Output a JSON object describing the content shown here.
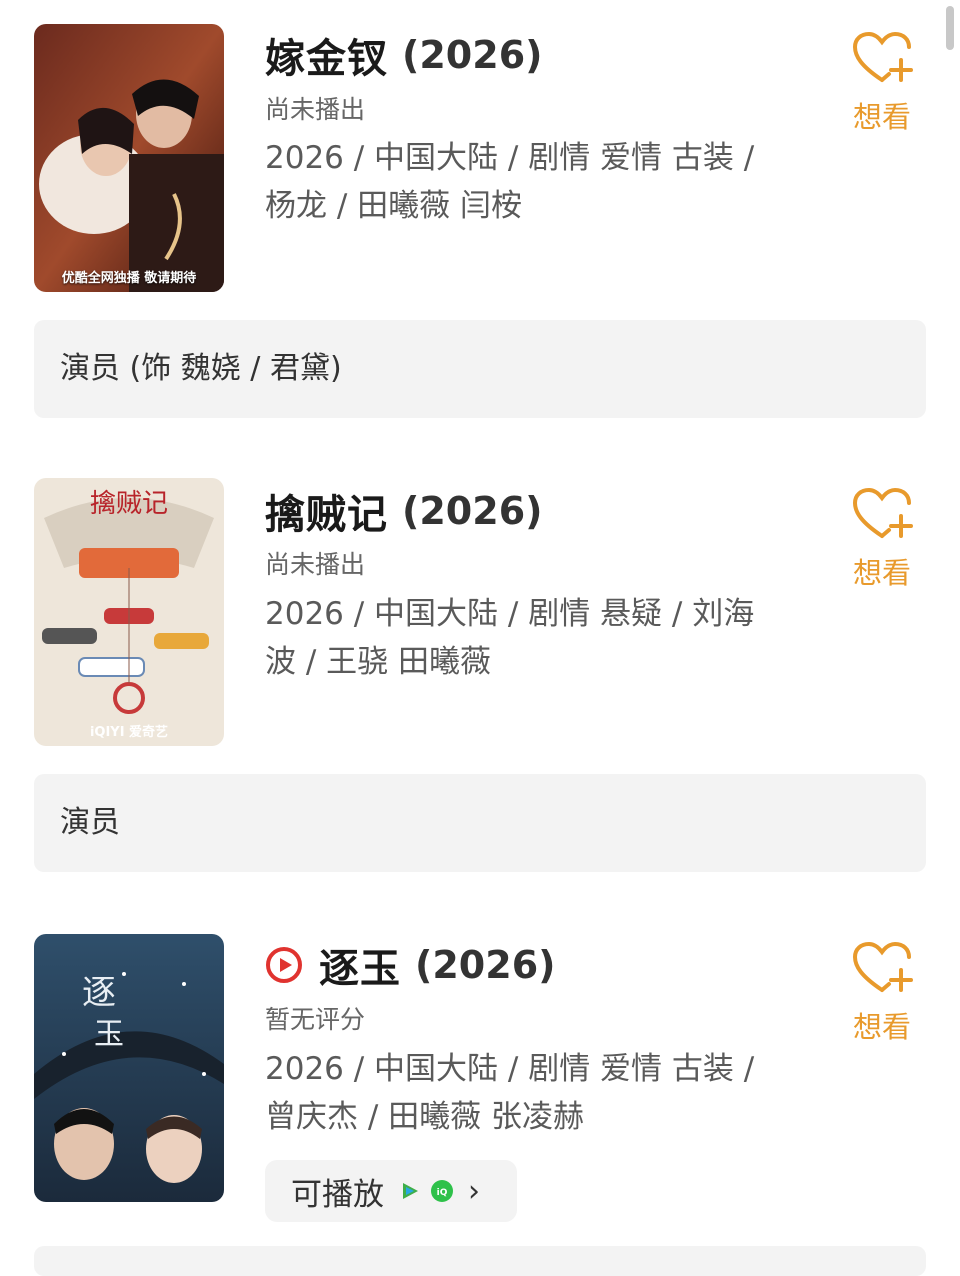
{
  "items": [
    {
      "title": "嫁金钗",
      "year": "(2026)",
      "status": "尚未播出",
      "meta": "2026 / 中国大陆 / 剧情 爱情 古装 / 杨龙 / 田曦薇 闫桉",
      "poster_caption": "优酷全网独播 敬请期待",
      "want_label": "想看",
      "actor_bar": "演员 (饰 魏娆 / 君黛)"
    },
    {
      "title": "擒贼记",
      "year": "(2026)",
      "status": "尚未播出",
      "meta": "2026 / 中国大陆 / 剧情 悬疑 / 刘海波 / 王骁 田曦薇",
      "poster_caption": "iQIYI 爱奇艺",
      "want_label": "想看",
      "actor_bar": "演员"
    },
    {
      "title": "逐玉",
      "year": "(2026)",
      "status": "暂无评分",
      "meta": "2026 / 中国大陆 / 剧情 爱情 古装 / 曾庆杰 / 田曦薇 张凌赫",
      "want_label": "想看",
      "playable_label": "可播放",
      "has_play_icon": true
    }
  ],
  "colors": {
    "accent": "#e89a2c",
    "play_red": "#e0332f",
    "card_bg": "#f3f3f3"
  },
  "icons": [
    "heart-plus-icon",
    "play-circle-icon",
    "tencent-video-icon",
    "iqiyi-icon",
    "chevron-right-icon"
  ]
}
